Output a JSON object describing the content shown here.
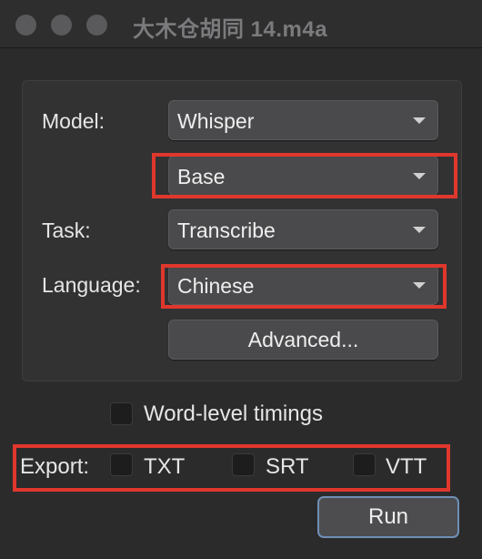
{
  "window": {
    "title": "大木仓胡同 14.m4a"
  },
  "form": {
    "model_label": "Model:",
    "model_value": "Whisper",
    "size_value": "Base",
    "task_label": "Task:",
    "task_value": "Transcribe",
    "language_label": "Language:",
    "language_value": "Chinese",
    "advanced_label": "Advanced..."
  },
  "options": {
    "word_level_label": "Word-level timings"
  },
  "export": {
    "label": "Export:",
    "txt_label": "TXT",
    "srt_label": "SRT",
    "vtt_label": "VTT"
  },
  "actions": {
    "run_label": "Run"
  },
  "colors": {
    "highlight": "#e0372c",
    "focus_ring": "#6f8fb6"
  }
}
